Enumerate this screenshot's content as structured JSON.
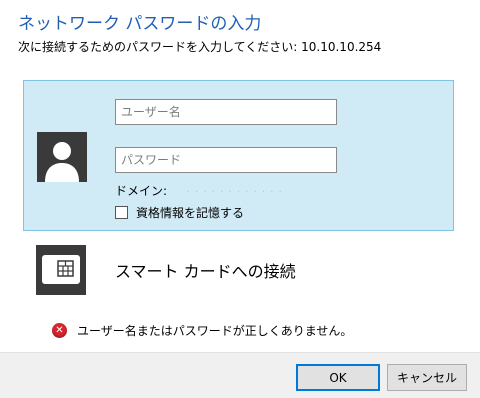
{
  "dialog": {
    "title": "ネットワーク パスワードの入力",
    "subtitle": "次に接続するためのパスワードを入力してください: 10.10.10.254"
  },
  "credentials": {
    "avatar_icon": "user-avatar-icon",
    "username_placeholder": "ユーザー名",
    "password_placeholder": "パスワード",
    "domain_label": "ドメイン:",
    "domain_value": "",
    "remember_label": "資格情報を記憶する",
    "remember_checked": false
  },
  "smartcard": {
    "icon": "smart-card-icon",
    "label": "スマート カードへの接続"
  },
  "error": {
    "icon": "error-x-icon",
    "message": "ユーザー名またはパスワードが正しくありません。"
  },
  "buttons": {
    "ok_label": "OK",
    "cancel_label": "キャンセル"
  },
  "colors": {
    "title": "#1f5fb4",
    "selected_panel_bg": "#d0ebf6",
    "selected_panel_border": "#7fc4e6",
    "error": "#d8262f",
    "primary_button_border": "#0078d7"
  }
}
